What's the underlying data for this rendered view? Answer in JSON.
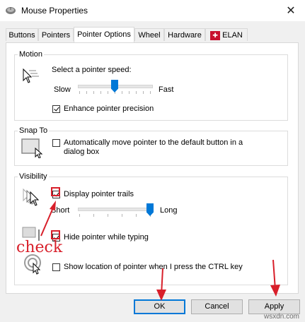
{
  "window": {
    "title": "Mouse Properties",
    "close_glyph": "✕"
  },
  "tabs": [
    {
      "label": "Buttons"
    },
    {
      "label": "Pointers"
    },
    {
      "label": "Pointer Options",
      "active": true
    },
    {
      "label": "Wheel"
    },
    {
      "label": "Hardware"
    },
    {
      "label": "ELAN",
      "icon": "elan-logo-icon"
    }
  ],
  "motion": {
    "legend": "Motion",
    "speed_label": "Select a pointer speed:",
    "slow_label": "Slow",
    "fast_label": "Fast",
    "speed_fraction": 0.5,
    "enhance_label": "Enhance pointer precision",
    "enhance_checked": true
  },
  "snap": {
    "legend": "Snap To",
    "auto_label_line1": "Automatically move pointer to the default button in a",
    "auto_label_line2": "dialog box",
    "auto_checked": false
  },
  "visibility": {
    "legend": "Visibility",
    "trails_label": "Display pointer trails",
    "trails_checked": true,
    "short_label": "Short",
    "long_label": "Long",
    "trail_fraction": 1.0,
    "hide_label": "Hide pointer while typing",
    "hide_checked": true,
    "show_label": "Show location of pointer when I press the CTRL key",
    "show_checked": false
  },
  "buttons": {
    "ok": "OK",
    "cancel": "Cancel",
    "apply": "Apply"
  },
  "annotation": {
    "word": "check",
    "color": "#d81f2a"
  },
  "watermark": "wsxdn.com"
}
